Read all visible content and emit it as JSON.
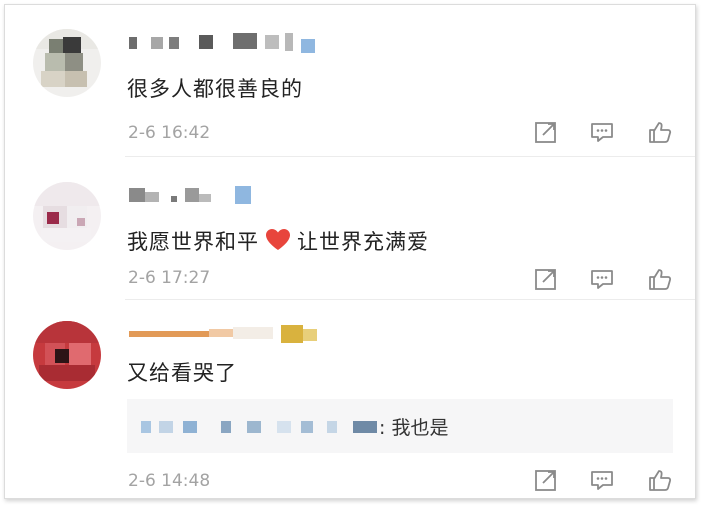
{
  "comments": [
    {
      "content": "很多人都很善良的",
      "time": "2-6 16:42",
      "actions": {
        "share_icon": "share-icon",
        "comment_icon": "comment-icon",
        "like_icon": "thumbs-up-icon"
      }
    },
    {
      "content_before": "我愿世界和平",
      "content_emoji": "heart-emoji",
      "content_after": "让世界充满爱",
      "time": "2-6 17:27",
      "actions": {
        "share_icon": "share-icon",
        "comment_icon": "comment-icon",
        "like_icon": "thumbs-up-icon"
      }
    },
    {
      "content": "又给看哭了",
      "reply": {
        "text": ": 我也是"
      },
      "time": "2-6 14:48",
      "actions": {
        "share_icon": "share-icon",
        "comment_icon": "comment-icon",
        "like_icon": "thumbs-up-icon"
      }
    }
  ],
  "colors": {
    "text": "#222222",
    "time": "#a3a3a3",
    "icon": "#8a8a8a",
    "heart": "#e8453c",
    "reply_bg": "#f6f6f7"
  }
}
